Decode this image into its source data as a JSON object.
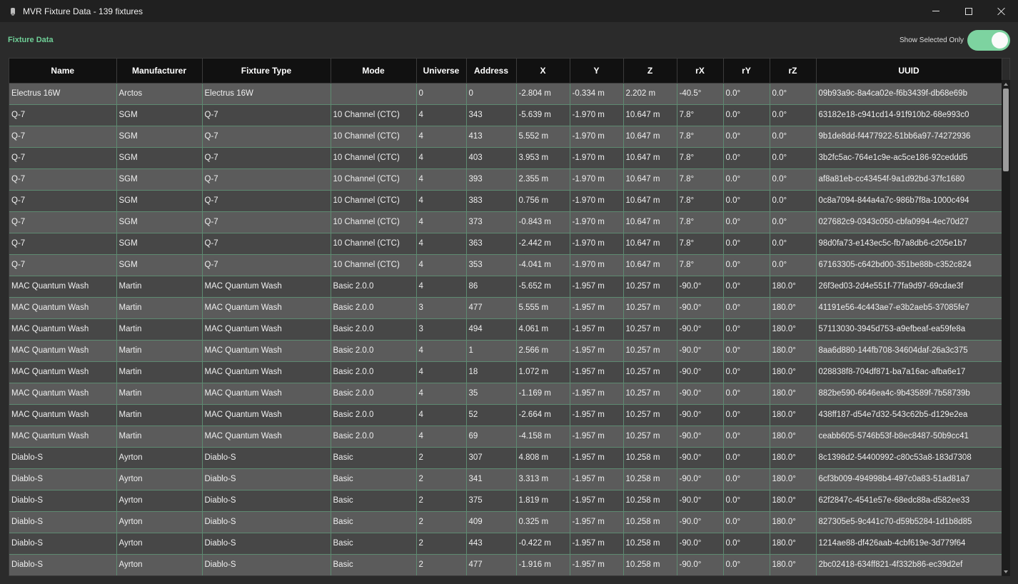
{
  "window": {
    "title": "MVR Fixture Data - 139 fixtures",
    "app_icon": "camera-icon",
    "controls": [
      "minimize-icon",
      "maximize-icon",
      "close-icon"
    ]
  },
  "section": {
    "label": "Fixture Data"
  },
  "toggle": {
    "label": "Show Selected Only",
    "on": true,
    "color": "#7dd3a0"
  },
  "colors": {
    "accent": "#6fcf97",
    "header_bg": "#111111",
    "row_odd": "#5b5b5b",
    "row_even": "#474747",
    "grid": "#5e8a71"
  },
  "table": {
    "columns": [
      "Name",
      "Manufacturer",
      "Fixture Type",
      "Mode",
      "Universe",
      "Address",
      "X",
      "Y",
      "Z",
      "rX",
      "rY",
      "rZ",
      "UUID"
    ],
    "rows": [
      [
        "Electrus 16W",
        "Arctos",
        "Electrus 16W",
        "",
        "0",
        "0",
        "-2.804 m",
        "-0.334 m",
        "2.202 m",
        "-40.5°",
        "0.0°",
        "0.0°",
        "09b93a9c-8a4ca02e-f6b3439f-db68e69b"
      ],
      [
        "Q-7",
        "SGM",
        "Q-7",
        "10 Channel (CTC)",
        "4",
        "343",
        "-5.639 m",
        "-1.970 m",
        "10.647 m",
        "7.8°",
        "0.0°",
        "0.0°",
        "63182e18-c941cd14-91f910b2-68e993c0"
      ],
      [
        "Q-7",
        "SGM",
        "Q-7",
        "10 Channel (CTC)",
        "4",
        "413",
        "5.552 m",
        "-1.970 m",
        "10.647 m",
        "7.8°",
        "0.0°",
        "0.0°",
        "9b1de8dd-f4477922-51bb6a97-74272936"
      ],
      [
        "Q-7",
        "SGM",
        "Q-7",
        "10 Channel (CTC)",
        "4",
        "403",
        "3.953 m",
        "-1.970 m",
        "10.647 m",
        "7.8°",
        "0.0°",
        "0.0°",
        "3b2fc5ac-764e1c9e-ac5ce186-92ceddd5"
      ],
      [
        "Q-7",
        "SGM",
        "Q-7",
        "10 Channel (CTC)",
        "4",
        "393",
        "2.355 m",
        "-1.970 m",
        "10.647 m",
        "7.8°",
        "0.0°",
        "0.0°",
        "af8a81eb-cc43454f-9a1d92bd-37fc1680"
      ],
      [
        "Q-7",
        "SGM",
        "Q-7",
        "10 Channel (CTC)",
        "4",
        "383",
        "0.756 m",
        "-1.970 m",
        "10.647 m",
        "7.8°",
        "0.0°",
        "0.0°",
        "0c8a7094-844a4a7c-986b7f8a-1000c494"
      ],
      [
        "Q-7",
        "SGM",
        "Q-7",
        "10 Channel (CTC)",
        "4",
        "373",
        "-0.843 m",
        "-1.970 m",
        "10.647 m",
        "7.8°",
        "0.0°",
        "0.0°",
        "027682c9-0343c050-cbfa0994-4ec70d27"
      ],
      [
        "Q-7",
        "SGM",
        "Q-7",
        "10 Channel (CTC)",
        "4",
        "363",
        "-2.442 m",
        "-1.970 m",
        "10.647 m",
        "7.8°",
        "0.0°",
        "0.0°",
        "98d0fa73-e143ec5c-fb7a8db6-c205e1b7"
      ],
      [
        "Q-7",
        "SGM",
        "Q-7",
        "10 Channel (CTC)",
        "4",
        "353",
        "-4.041 m",
        "-1.970 m",
        "10.647 m",
        "7.8°",
        "0.0°",
        "0.0°",
        "67163305-c642bd00-351be88b-c352c824"
      ],
      [
        "MAC Quantum Wash",
        "Martin",
        "MAC Quantum Wash",
        "Basic 2.0.0",
        "4",
        "86",
        "-5.652 m",
        "-1.957 m",
        "10.257 m",
        "-90.0°",
        "0.0°",
        "180.0°",
        "26f3ed03-2d4e551f-77fa9d97-69cdae3f"
      ],
      [
        "MAC Quantum Wash",
        "Martin",
        "MAC Quantum Wash",
        "Basic 2.0.0",
        "3",
        "477",
        "5.555 m",
        "-1.957 m",
        "10.257 m",
        "-90.0°",
        "0.0°",
        "180.0°",
        "41191e56-4c443ae7-e3b2aeb5-37085fe7"
      ],
      [
        "MAC Quantum Wash",
        "Martin",
        "MAC Quantum Wash",
        "Basic 2.0.0",
        "3",
        "494",
        "4.061 m",
        "-1.957 m",
        "10.257 m",
        "-90.0°",
        "0.0°",
        "180.0°",
        "57113030-3945d753-a9efbeaf-ea59fe8a"
      ],
      [
        "MAC Quantum Wash",
        "Martin",
        "MAC Quantum Wash",
        "Basic 2.0.0",
        "4",
        "1",
        "2.566 m",
        "-1.957 m",
        "10.257 m",
        "-90.0°",
        "0.0°",
        "180.0°",
        "8aa6d880-144fb708-34604daf-26a3c375"
      ],
      [
        "MAC Quantum Wash",
        "Martin",
        "MAC Quantum Wash",
        "Basic 2.0.0",
        "4",
        "18",
        "1.072 m",
        "-1.957 m",
        "10.257 m",
        "-90.0°",
        "0.0°",
        "180.0°",
        "028838f8-704df871-ba7a16ac-afba6e17"
      ],
      [
        "MAC Quantum Wash",
        "Martin",
        "MAC Quantum Wash",
        "Basic 2.0.0",
        "4",
        "35",
        "-1.169 m",
        "-1.957 m",
        "10.257 m",
        "-90.0°",
        "0.0°",
        "180.0°",
        "882be590-6646ea4c-9b43589f-7b58739b"
      ],
      [
        "MAC Quantum Wash",
        "Martin",
        "MAC Quantum Wash",
        "Basic 2.0.0",
        "4",
        "52",
        "-2.664 m",
        "-1.957 m",
        "10.257 m",
        "-90.0°",
        "0.0°",
        "180.0°",
        "438ff187-d54e7d32-543c62b5-d129e2ea"
      ],
      [
        "MAC Quantum Wash",
        "Martin",
        "MAC Quantum Wash",
        "Basic 2.0.0",
        "4",
        "69",
        "-4.158 m",
        "-1.957 m",
        "10.257 m",
        "-90.0°",
        "0.0°",
        "180.0°",
        "ceabb605-5746b53f-b8ec8487-50b9cc41"
      ],
      [
        "Diablo-S",
        "Ayrton",
        "Diablo-S",
        "Basic",
        "2",
        "307",
        "4.808 m",
        "-1.957 m",
        "10.258 m",
        "-90.0°",
        "0.0°",
        "180.0°",
        "8c1398d2-54400992-c80c53a8-183d7308"
      ],
      [
        "Diablo-S",
        "Ayrton",
        "Diablo-S",
        "Basic",
        "2",
        "341",
        "3.313 m",
        "-1.957 m",
        "10.258 m",
        "-90.0°",
        "0.0°",
        "180.0°",
        "6cf3b009-494998b4-497c0a83-51ad81a7"
      ],
      [
        "Diablo-S",
        "Ayrton",
        "Diablo-S",
        "Basic",
        "2",
        "375",
        "1.819 m",
        "-1.957 m",
        "10.258 m",
        "-90.0°",
        "0.0°",
        "180.0°",
        "62f2847c-4541e57e-68edc88a-d582ee33"
      ],
      [
        "Diablo-S",
        "Ayrton",
        "Diablo-S",
        "Basic",
        "2",
        "409",
        "0.325 m",
        "-1.957 m",
        "10.258 m",
        "-90.0°",
        "0.0°",
        "180.0°",
        "827305e5-9c441c70-d59b5284-1d1b8d85"
      ],
      [
        "Diablo-S",
        "Ayrton",
        "Diablo-S",
        "Basic",
        "2",
        "443",
        "-0.422 m",
        "-1.957 m",
        "10.258 m",
        "-90.0°",
        "0.0°",
        "180.0°",
        "1214ae88-df426aab-4cbf619e-3d779f64"
      ],
      [
        "Diablo-S",
        "Ayrton",
        "Diablo-S",
        "Basic",
        "2",
        "477",
        "-1.916 m",
        "-1.957 m",
        "10.258 m",
        "-90.0°",
        "0.0°",
        "180.0°",
        "2bc02418-634ff821-4f332b86-ec39d2ef"
      ]
    ]
  }
}
